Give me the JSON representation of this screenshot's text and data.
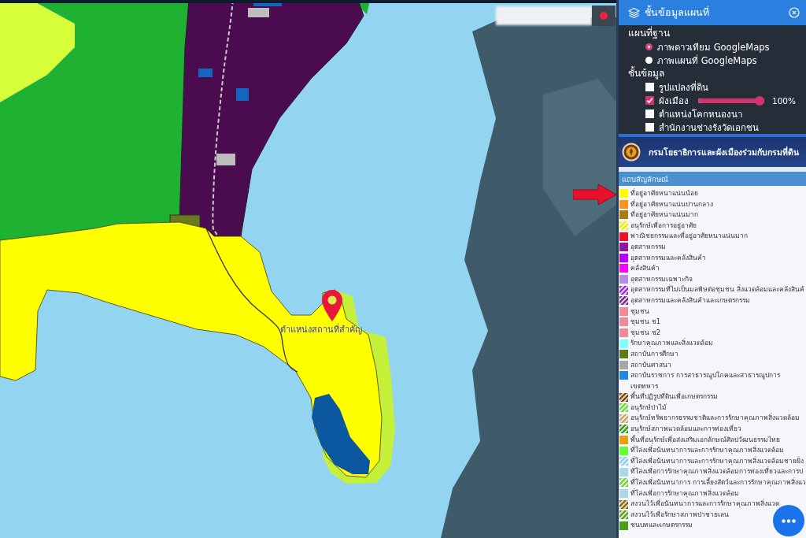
{
  "map": {
    "place_label": "ตำแหน่งสถานที่สำคัญ"
  },
  "layer_panel": {
    "title": "ชั้นข้อมูลแผนที่",
    "basemap": {
      "heading": "แผนที่ฐาน",
      "options": [
        {
          "label": "ภาพดาวเทียม GoogleMaps",
          "selected": true
        },
        {
          "label": "ภาพแผนที่ GoogleMaps",
          "selected": false
        }
      ]
    },
    "layers": {
      "heading": "ชั้นข้อมูล",
      "items": [
        {
          "kind": "checkbox",
          "label": "รูปแปลงที่ดิน",
          "checked": false
        },
        {
          "kind": "checkbox_slider",
          "label": "ผังเมือง",
          "checked": true,
          "opacity": {
            "level": 1,
            "reading": "100%"
          }
        },
        {
          "kind": "checkbox",
          "label": "ตำแหน่งโคกหนองนา",
          "checked": false
        },
        {
          "kind": "checkbox",
          "label": "สำนักงานช่างรังวัดเอกชน",
          "checked": false
        }
      ]
    }
  },
  "source": {
    "title": "กรมโยธาธิการและผังเมืองร่วมกับกรมที่ดิน"
  },
  "legend": {
    "title": "แถบสัญลักษณ์",
    "items": [
      {
        "kind": "solid",
        "label": "ที่อยู่อาศัยหนาแน่นน้อย",
        "color": "#ffff00"
      },
      {
        "kind": "solid",
        "label": "ที่อยู่อาศัยหนาแน่นปานกลาง",
        "color": "#f7941d"
      },
      {
        "kind": "solid",
        "label": "ที่อยู่อาศัยหนาแน่นมาก",
        "color": "#a67c1a"
      },
      {
        "kind": "hatch",
        "label": "อนุรักษ์เพื่อการอยู่อาศัย",
        "color": "#f5e616"
      },
      {
        "kind": "solid",
        "label": "พาณิชยกรรมและที่อยู่อาศัยหนาแน่นมาก",
        "color": "#ee1122"
      },
      {
        "kind": "solid",
        "label": "อุตสาหกรรม",
        "color": "#8b1a9c"
      },
      {
        "kind": "solid",
        "label": "อุตสาหกรรมและคลังสินค้า",
        "color": "#b200ff"
      },
      {
        "kind": "solid",
        "label": "คลังสินค้า",
        "color": "#ff00ff"
      },
      {
        "kind": "solid",
        "label": "อุตสาหกรรมเฉพาะกิจ",
        "color": "#b48ee6"
      },
      {
        "kind": "hatch",
        "label": "อุตสาหกรรมที่ไม่เป็นมลพิษต่อชุมชน สิ่งแวดล้อมและคลังสินค้",
        "color": "#9b2fd6"
      },
      {
        "kind": "hatch",
        "label": "อุตสาหกรรมและคลังสินค้าและเกษตรกรรม",
        "color": "#7b2d8e"
      },
      {
        "kind": "solid",
        "label": "ชุมชน",
        "color": "#ef8a9a"
      },
      {
        "kind": "solid",
        "label": "ชุมชน ช1",
        "color": "#ef8a9a"
      },
      {
        "kind": "solid",
        "label": "ชุมชน ช2",
        "color": "#ef8a9a"
      },
      {
        "kind": "solid",
        "label": "รักษาคุณภาพและสิ่งแวดล้อม",
        "color": "#80ffff"
      },
      {
        "kind": "solid",
        "label": "สถาบันการศึกษา",
        "color": "#5d7a1a"
      },
      {
        "kind": "solid",
        "label": "สถาบันศาสนา",
        "color": "#a8a8a8"
      },
      {
        "kind": "solid",
        "label": "สถาบันราชการ การสาธารณูปโภคและสาธารณูปการ",
        "color": "#1e88e5"
      },
      {
        "kind": "plain",
        "label": "เขตทหาร"
      },
      {
        "kind": "hatch",
        "label": "พื้นที่ปฏิรูปที่ดินเพื่อเกษตรกรรม",
        "color": "#7a4a10"
      },
      {
        "kind": "hatch",
        "label": "อนุรักษ์ป่าไม้",
        "color": "#70d838"
      },
      {
        "kind": "hatch",
        "label": "อนุรักษ์ทรัพยากรธรรมชาติและการรักษาคุณภาพสิ่งแวดล้อม",
        "color": "#c8a870"
      },
      {
        "kind": "hatch",
        "label": "อนุรักษ์สภาพแวดล้อมและการท่องเที่ยว",
        "color": "#3a9a20"
      },
      {
        "kind": "solid",
        "label": "พื้นที่อนุรักษ์เพื่อส่งเสริมเอกลักษณ์ศิลปวัฒนธรรมไทย",
        "color": "#e8a010"
      },
      {
        "kind": "solid",
        "label": "ที่โล่งเพื่อนันทนาการและการรักษาคุณภาพสิ่งแวดล้อม",
        "color": "#66ff33"
      },
      {
        "kind": "hatch",
        "label": "ที่โล่งเพื่อนันทนาการและการรักษาคุณภาพสิ่งแวดล้อมชายฝั่ง",
        "color": "#8fcbea"
      },
      {
        "kind": "solid",
        "label": "ที่โล่งเพื่อการรักษาคุณภาพสิ่งแวดล้อมการท่องเที่ยวและการป",
        "color": "#a8d8ea"
      },
      {
        "kind": "hatch",
        "label": "ที่โล่งเพื่อนันทนาการ การเลี้ยงสัตว์และการรักษาคุณภาพสิ่งแว",
        "color": "#7ad040"
      },
      {
        "kind": "solid",
        "label": "ที่โล่งเพื่อการรักษาคุณภาพสิ่งแวดล้อม",
        "color": "#a8d8ea"
      },
      {
        "kind": "hatch",
        "label": "สงวนไว้เพื่อนันทนาการและการรักษาคุณภาพสิ่งแวด",
        "color": "#8a6a10"
      },
      {
        "kind": "hatch",
        "label": "สงวนไว้เพื่อรักษาสภาพป่าชายเลน",
        "color": "#5aa020"
      },
      {
        "kind": "solid",
        "label": "ชนบทและเกษตรกรรม",
        "color": "#4aa01a"
      }
    ]
  }
}
